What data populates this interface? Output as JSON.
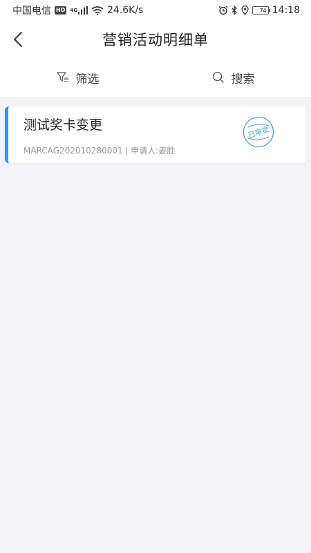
{
  "status_bar": {
    "carrier": "中国电信",
    "hd": "HD",
    "network": "4G",
    "speed": "24.6K/s",
    "battery": "74",
    "time": "14:18"
  },
  "header": {
    "title": "营销活动明细单"
  },
  "toolbar": {
    "filter_label": "筛选",
    "search_label": "搜索"
  },
  "list": {
    "items": [
      {
        "title": "测试奖卡变更",
        "code": "MARCAG202010280001",
        "applicant": "申请人:姜胜",
        "status": "已审批",
        "accent": "#3d8ff0",
        "stamp_color": "#4aa3c9"
      }
    ]
  }
}
